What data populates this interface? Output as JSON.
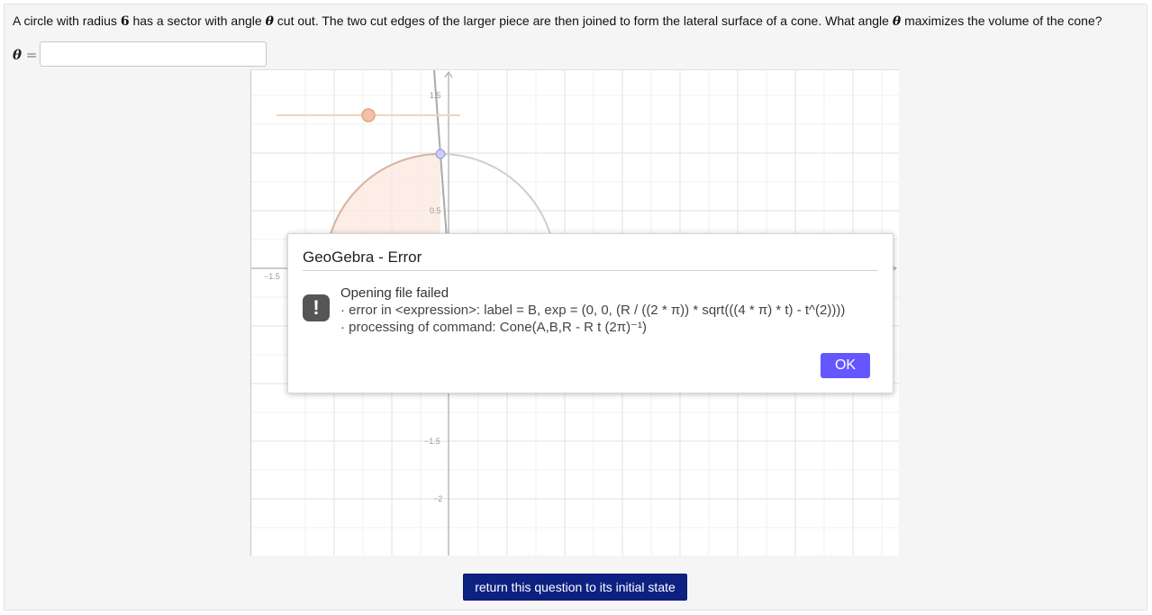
{
  "question": {
    "text_1": "A circle with radius ",
    "radius": "6",
    "text_2": " has a sector with angle ",
    "theta": "θ",
    "text_3": " cut out. The two cut edges of the larger piece are then joined to form the lateral surface of a cone. What angle ",
    "text_4": " maximizes the volume of the cone?"
  },
  "answer": {
    "label_var": "θ",
    "label_eq": " = ",
    "value": "",
    "placeholder": ""
  },
  "graph": {
    "axis_labels": {
      "y_1_5": "1.5",
      "y_0_5": "0.5",
      "x_neg_1_5": "−1.5",
      "y_neg_1_5": "−1.5",
      "y_neg_2": "−2"
    }
  },
  "dialog": {
    "title": "GeoGebra - Error",
    "icon": "exclamation-icon",
    "line_1": "Opening file failed",
    "line_2": "· error in <expression>: label = B, exp = (0, 0, (R / ((2 * π)) * sqrt(((4 * π) * t) - t^(2))))",
    "line_3": "· processing of command: Cone(A,B,R - R t (2π)⁻¹)",
    "ok_label": "OK"
  },
  "reset_button": {
    "label": "return this question to its initial state"
  },
  "colors": {
    "ok_button": "#6557ff",
    "reset_button": "#0d2182",
    "slider": "#e8a27a"
  }
}
